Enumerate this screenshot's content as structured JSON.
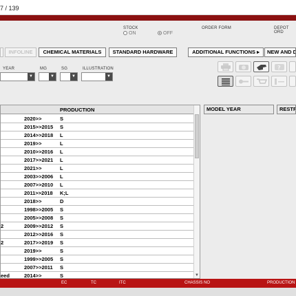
{
  "window": {
    "title_fragment": "7 / 139"
  },
  "header": {
    "stock_label": "STOCK",
    "stock_on": "ON",
    "stock_off": "OFF",
    "order_form_label": "ORDER FORM",
    "depot_label": "DEPOT ORD"
  },
  "tabs": [
    {
      "label": ""
    },
    {
      "label": "INFOLINE"
    },
    {
      "label": "CHEMICAL MATERIALS"
    },
    {
      "label": "STANDARD HARDWARE"
    },
    {
      "label": "ADDITIONAL FUNCTIONS ▸"
    },
    {
      "label": "NEW AND D"
    }
  ],
  "filters": {
    "year_label": "YEAR",
    "mg_label": "MG",
    "sg_label": "SG",
    "illustration_label": "ILLUSTRATION"
  },
  "table": {
    "production_header": "PRODUCTION",
    "rows": [
      {
        "year": "2020>>",
        "prod": "S",
        "mark": ""
      },
      {
        "year": "2015>>2015",
        "prod": "S",
        "mark": ""
      },
      {
        "year": "2014>>2018",
        "prod": "L",
        "mark": ""
      },
      {
        "year": "2019>>",
        "prod": "L",
        "mark": ""
      },
      {
        "year": "2010>>2016",
        "prod": "L",
        "mark": ""
      },
      {
        "year": "2017>>2021",
        "prod": "L",
        "mark": ""
      },
      {
        "year": "2021>>",
        "prod": "L",
        "mark": ""
      },
      {
        "year": "2003>>2006",
        "prod": "L",
        "mark": ""
      },
      {
        "year": "2007>>2010",
        "prod": "L",
        "mark": ""
      },
      {
        "year": "2011>>2018",
        "prod": "K;L",
        "mark": ""
      },
      {
        "year": "2018>>",
        "prod": "D",
        "mark": ""
      },
      {
        "year": "1998>>2005",
        "prod": "S",
        "mark": ""
      },
      {
        "year": "2005>>2008",
        "prod": "S",
        "mark": ""
      },
      {
        "year": "2009>>2012",
        "prod": "S",
        "mark": "2"
      },
      {
        "year": "2012>>2016",
        "prod": "S",
        "mark": ""
      },
      {
        "year": "2017>>2019",
        "prod": "S",
        "mark": "2"
      },
      {
        "year": "2019>>",
        "prod": "S",
        "mark": ""
      },
      {
        "year": "1999>>2005",
        "prod": "S",
        "mark": ""
      },
      {
        "year": "2007>>2011",
        "prod": "S",
        "mark": ""
      },
      {
        "year": "2014>>",
        "prod": "S",
        "mark": "eed"
      }
    ]
  },
  "side": {
    "model_year_header": "MODEL YEAR",
    "restr_header": "RESTR"
  },
  "footer": {
    "ec": "EC",
    "tc": "TC",
    "itc": "ITC",
    "chassis_no": "CHASSIS NO",
    "production": "PRODUCTION"
  },
  "colors": {
    "brand_red": "#b81414",
    "dark_red": "#8b1111"
  }
}
